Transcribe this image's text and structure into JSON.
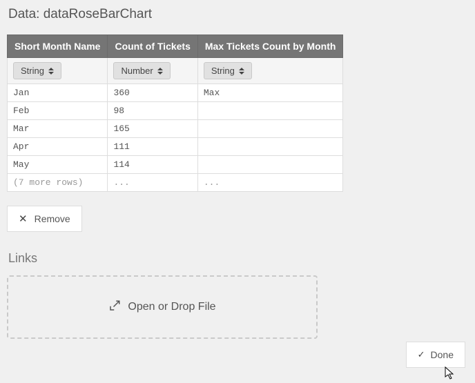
{
  "title": "Data: dataRoseBarChart",
  "columns": [
    {
      "header": "Short Month Name",
      "type": "String"
    },
    {
      "header": "Count of Tickets",
      "type": "Number"
    },
    {
      "header": "Max Tickets Count by Month",
      "type": "String"
    }
  ],
  "rows": [
    {
      "c1": "Jan",
      "c2": "360",
      "c3": "Max"
    },
    {
      "c1": "Feb",
      "c2": "98",
      "c3": ""
    },
    {
      "c1": "Mar",
      "c2": "165",
      "c3": ""
    },
    {
      "c1": "Apr",
      "c2": "111",
      "c3": ""
    },
    {
      "c1": "May",
      "c2": "114",
      "c3": ""
    }
  ],
  "lastRow": {
    "c1": "(7 more rows)",
    "c2": "...",
    "c3": "..."
  },
  "removeLabel": "Remove",
  "linksTitle": "Links",
  "dropzoneLabel": "Open or Drop File",
  "doneLabel": "Done"
}
